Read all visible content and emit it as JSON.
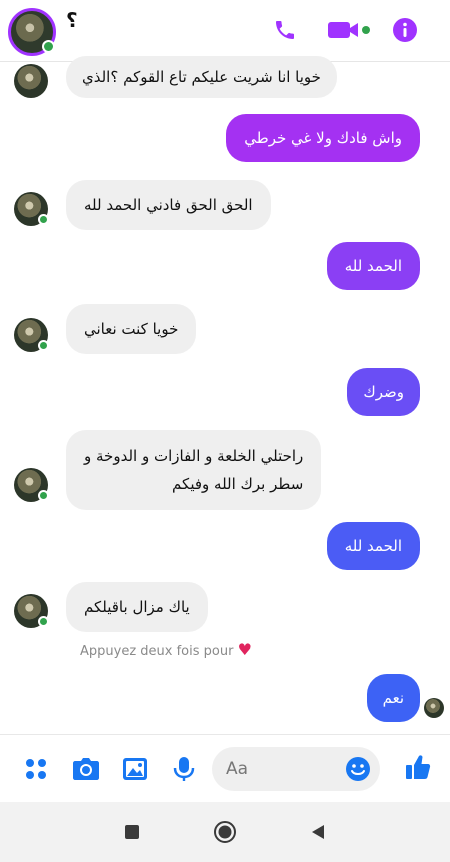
{
  "header": {
    "name": "؟",
    "icons": [
      "phone-icon",
      "video-camera-icon",
      "info-icon"
    ],
    "accent": "#a033ff"
  },
  "messages": [
    {
      "dir": "in",
      "text": "خويا انا شريت عليكم تاع القوكم ؟الذي"
    },
    {
      "dir": "out",
      "text": "واش فادك ولا غي خرطي"
    },
    {
      "dir": "in",
      "text": "الحق الحق فادني الحمد لله"
    },
    {
      "dir": "out",
      "text": "الحمد لله"
    },
    {
      "dir": "in",
      "text": "خويا كنت نعاني"
    },
    {
      "dir": "out",
      "text": "وضرك"
    },
    {
      "dir": "in",
      "lines": [
        "راحتلي الخلعة و الفازات و الدوخة و",
        "سطر برك الله وفيكم"
      ]
    },
    {
      "dir": "out",
      "text": "الحمد لله"
    },
    {
      "dir": "in",
      "text": "ياك مزال باقيلكم"
    },
    {
      "dir": "out",
      "text": "نعم"
    }
  ],
  "hint": {
    "text": "Appuyez deux fois pour",
    "icon": "heart-icon"
  },
  "composer": {
    "placeholder": "Aa",
    "icons": [
      "menu-dots-icon",
      "camera-icon",
      "gallery-icon",
      "microphone-icon",
      "emoji-icon",
      "like-icon"
    ]
  },
  "colors": {
    "out_purple": "#a431f2",
    "out_violet": "#7a45f5",
    "out_indigo": "#5a55f5",
    "out_blue": "#3d62f5",
    "in_bubble": "#efefef",
    "online": "#31a24c"
  }
}
